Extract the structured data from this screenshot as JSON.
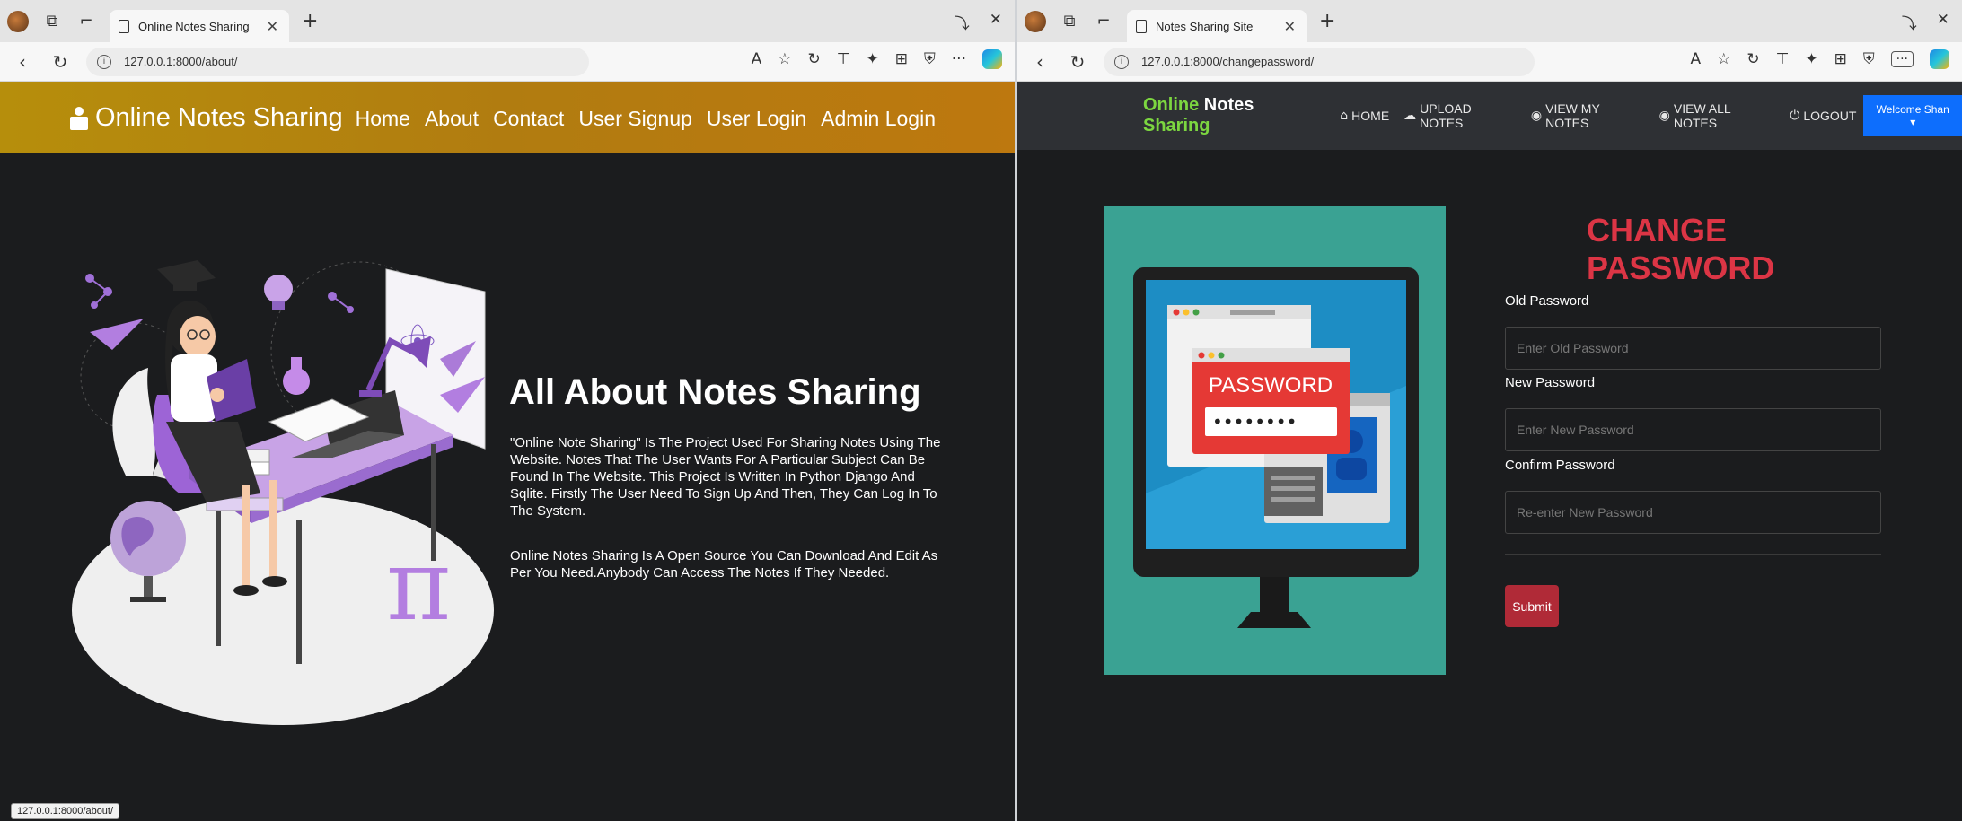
{
  "left": {
    "tab_title": "Online Notes Sharing",
    "url": "127.0.0.1:8000/about/",
    "brand": "Online Notes Sharing",
    "nav": [
      "Home",
      "About",
      "Contact",
      "User Signup",
      "User Login",
      "Admin Login"
    ],
    "about_title": "All About Notes Sharing",
    "about_p1": "\"Online Note Sharing\" Is The Project Used For Sharing Notes Using The Website. Notes That The User Wants For A Particular Subject Can Be Found In The Website. This Project Is Written In Python Django And Sqlite. Firstly The User Need To Sign Up And Then, They Can Log In To The System.",
    "about_p2": "Online Notes Sharing Is A Open Source You Can Download And Edit As Per You Need.Anybody Can Access The Notes If They Needed.",
    "status_url": "127.0.0.1:8000/about/"
  },
  "right": {
    "tab_title": "Notes Sharing Site",
    "url": "127.0.0.1:8000/changepassword/",
    "brand_part1": "Online",
    "brand_part2": "Notes",
    "brand_part3": "Sharing",
    "nav": [
      {
        "icon": "home-icon",
        "glyph": "⌂",
        "label": "HOME"
      },
      {
        "icon": "upload-icon",
        "glyph": "☁",
        "label": "UPLOAD NOTES"
      },
      {
        "icon": "eye-icon",
        "glyph": "◉",
        "label": "VIEW MY NOTES"
      },
      {
        "icon": "eye-icon",
        "glyph": "◉",
        "label": "VIEW ALL NOTES"
      },
      {
        "icon": "power-icon",
        "glyph": "⏻",
        "label": "LOGOUT"
      }
    ],
    "welcome": "Welcome Shan ▾",
    "title": "CHANGE PASSWORD",
    "old_label": "Old Password",
    "old_placeholder": "Enter Old Password",
    "new_label": "New Password",
    "new_placeholder": "Enter New Password",
    "confirm_label": "Confirm Password",
    "confirm_placeholder": "Re-enter New Password",
    "submit": "Submit",
    "illus_password_text": "PASSWORD",
    "illus_password_dots": "••••••••"
  },
  "colors": {
    "left_header": "#b17c10",
    "right_header": "#2e3034",
    "accent_green": "#7cd640",
    "danger": "#dc3545",
    "primary": "#0d6efd",
    "illus_teal": "#3aa293"
  }
}
